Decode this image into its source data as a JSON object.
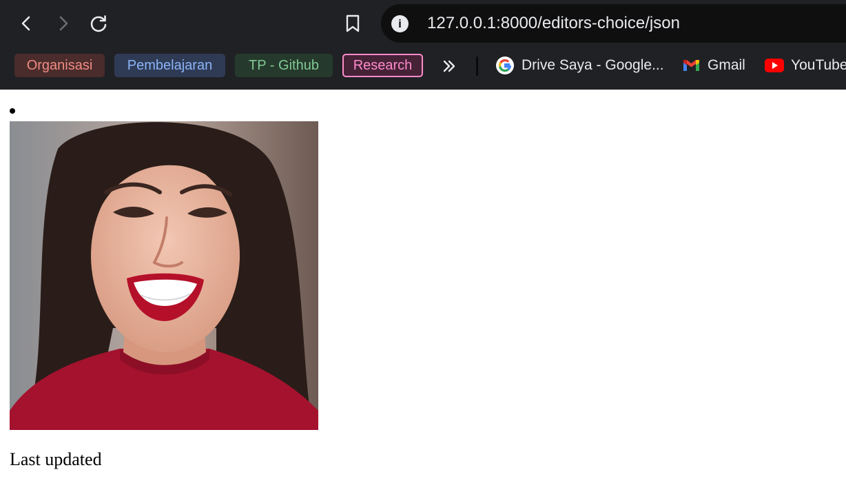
{
  "browser": {
    "address_bar": {
      "url": "127.0.0.1:8000/editors-choice/json"
    },
    "bookmarks": {
      "groups": [
        {
          "label": "Organisasi",
          "text_color": "#f28b82",
          "bg_color": "#4a2c2c"
        },
        {
          "label": "Pembelajaran",
          "text_color": "#8ab4f8",
          "bg_color": "#2f3b55"
        },
        {
          "label": "TP - Github",
          "text_color": "#81c995",
          "bg_color": "#253a2c"
        },
        {
          "label": "Research",
          "text_color": "#ff8bcb",
          "bg_color": "#462237"
        }
      ],
      "items": [
        {
          "label": "Drive Saya - Google...",
          "icon": "google-icon"
        },
        {
          "label": "Gmail",
          "icon": "gmail-icon"
        },
        {
          "label": "YouTube",
          "icon": "youtube-icon"
        }
      ]
    }
  },
  "page": {
    "caption": "Last updated"
  }
}
